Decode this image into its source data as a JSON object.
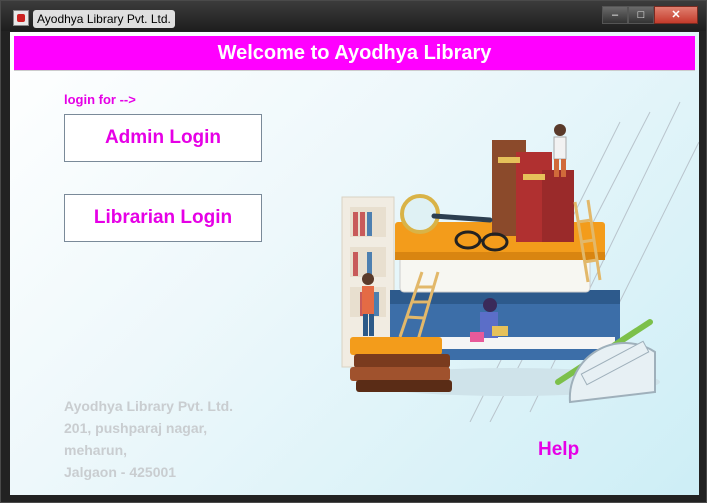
{
  "window": {
    "title": "Ayodhya Library Pvt. Ltd."
  },
  "window_controls": {
    "minimize": "–",
    "maximize": "□",
    "close": "✕"
  },
  "header": {
    "title": "Welcome to Ayodhya Library"
  },
  "login": {
    "prompt": "login for -->",
    "admin_label": "Admin Login",
    "librarian_label": "Librarian Login"
  },
  "address": {
    "line1": "Ayodhya Library Pvt. Ltd.",
    "line2": "201, pushparaj nagar,",
    "line3": "meharun,",
    "line4": "Jalgaon - 425001"
  },
  "help_label": "Help",
  "colors": {
    "accent": "#ff00ff",
    "text_accent": "#e600e6",
    "address": "#c9cdd0"
  },
  "icons": {
    "app": "library-app-icon",
    "illustration": "books-stack-illustration"
  }
}
